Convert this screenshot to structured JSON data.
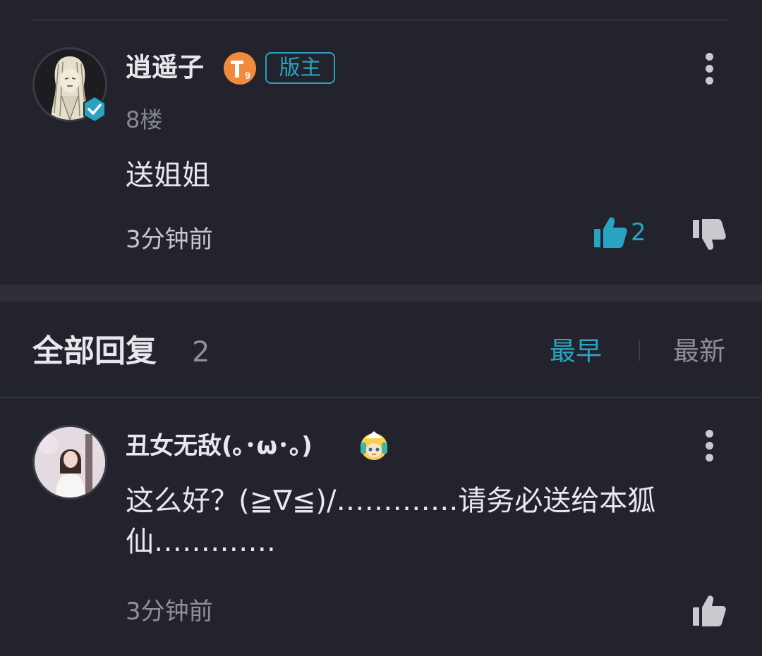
{
  "post": {
    "username": "逍遥子",
    "level_badge": "T9",
    "role_badge": "版主",
    "floor": "8楼",
    "content": "送姐姐",
    "time": "3分钟前",
    "like_count": "2"
  },
  "replies_header": {
    "title": "全部回复",
    "count": "2",
    "sort_earliest": "最早",
    "sort_latest": "最新"
  },
  "reply": {
    "username": "丑女无敌(｡･ω･｡)",
    "content": "这么好？(≧∇≦)/………….请务必送给本狐仙………….",
    "time": "3分钟前"
  },
  "colors": {
    "background": "#22232c",
    "accent": "#2aa3c0",
    "secondary_text": "#8e8f98",
    "level_badge": "#f08a3c"
  },
  "icons": {
    "more": "more-vertical-icon",
    "like": "thumbs-up-icon",
    "dislike": "thumbs-down-icon",
    "verified": "verified-check-icon"
  }
}
